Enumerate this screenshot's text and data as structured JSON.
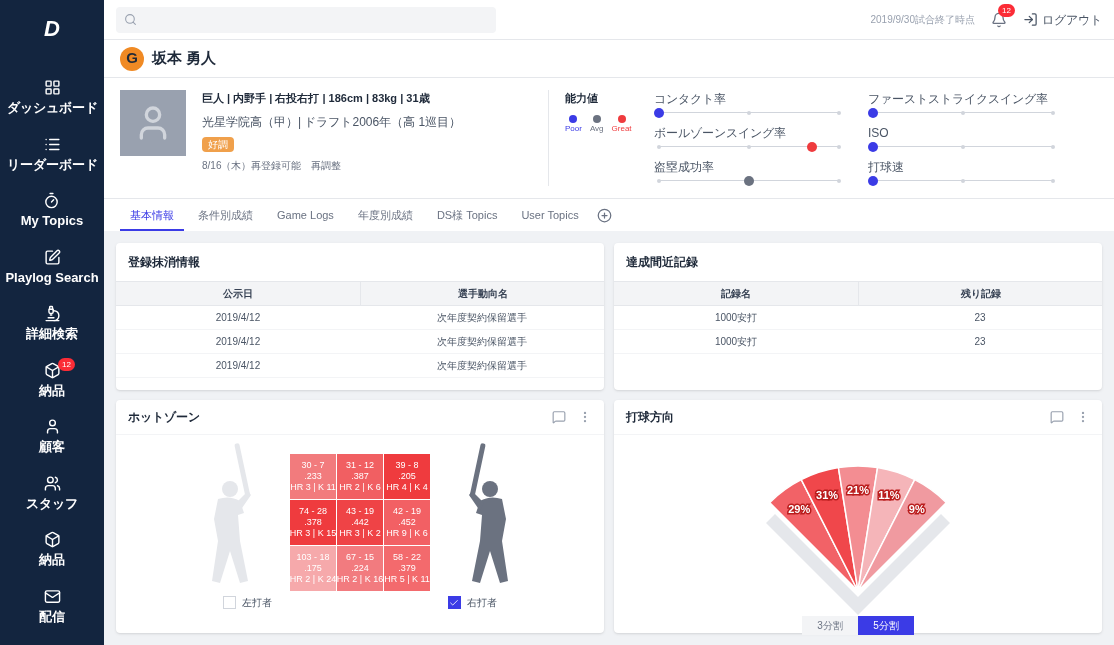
{
  "header": {
    "status": "2019/9/30試合終了時点",
    "notification_count": "12",
    "logout": "ログアウト"
  },
  "sidebar": {
    "logo": "D",
    "items": [
      {
        "label": "ダッシュボード"
      },
      {
        "label": "リーダーボード"
      },
      {
        "label": "My Topics"
      },
      {
        "label": "Playlog Search"
      },
      {
        "label": "詳細検索"
      },
      {
        "label": "納品",
        "badge": "12"
      },
      {
        "label": "顧客"
      },
      {
        "label": "スタッフ"
      },
      {
        "label": "納品"
      },
      {
        "label": "配信"
      }
    ]
  },
  "player": {
    "team_mark": "G",
    "name": "坂本 勇人",
    "profile": "巨人 | 内野手 | 右投右打 | 186cm | 83kg | 31歳",
    "background": "光星学院高（甲）| ドラフト2006年（高 1巡目）",
    "tag": "好調",
    "note": "8/16（木）再登録可能　再調整"
  },
  "ability": {
    "title": "能力値",
    "legend": [
      {
        "label": "Poor",
        "color": "#3b3be6"
      },
      {
        "label": "Avg",
        "color": "#6b7280"
      },
      {
        "label": "Great",
        "color": "#ef3b3e"
      }
    ],
    "metrics": [
      {
        "label": "コンタクト率",
        "level": 0,
        "color": "#3b3be6"
      },
      {
        "label": "ファーストストライクスイング率",
        "level": 0,
        "color": "#3b3be6"
      },
      {
        "label": "ボールゾーンスイング率",
        "level": 0.85,
        "color": "#ef3b3e"
      },
      {
        "label": "ISO",
        "level": 0,
        "color": "#3b3be6"
      },
      {
        "label": "盗塁成功率",
        "level": 0.5,
        "color": "#6b7280"
      },
      {
        "label": "打球速",
        "level": 0,
        "color": "#3b3be6"
      }
    ]
  },
  "tabs": [
    {
      "label": "基本情報",
      "selected": true
    },
    {
      "label": "条件別成績",
      "selected": false
    },
    {
      "label": "Game Logs",
      "selected": false
    },
    {
      "label": "年度別成績",
      "selected": false
    },
    {
      "label": "DS様 Topics",
      "selected": false
    },
    {
      "label": "User Topics",
      "selected": false
    }
  ],
  "registration": {
    "title": "登録抹消情報",
    "columns": [
      "公示日",
      "選手動向名"
    ],
    "rows": [
      [
        "2019/4/12",
        "次年度契約保留選手"
      ],
      [
        "2019/4/12",
        "次年度契約保留選手"
      ],
      [
        "2019/4/12",
        "次年度契約保留選手"
      ]
    ]
  },
  "records": {
    "title": "達成間近記録",
    "columns": [
      "記録名",
      "残り記録"
    ],
    "rows": [
      [
        "1000安打",
        "23"
      ],
      [
        "1000安打",
        "23"
      ]
    ]
  },
  "hot_zone": {
    "title": "ホットゾーン",
    "cells": [
      {
        "lines": [
          "30 - 7",
          ".233",
          "HR 3 | K 11"
        ],
        "color": "#f27b7d"
      },
      {
        "lines": [
          "31 - 12",
          ".387",
          "HR 2 | K 6"
        ],
        "color": "#f15f62"
      },
      {
        "lines": [
          "39 - 8",
          ".205",
          "HR 4 | K 4"
        ],
        "color": "#ef3b3e"
      },
      {
        "lines": [
          "74 - 28",
          ".378",
          "HR 3 | K 15"
        ],
        "color": "#ef3b3e"
      },
      {
        "lines": [
          "43 - 19",
          ".442",
          "HR 3 | K 2"
        ],
        "color": "#ef4346"
      },
      {
        "lines": [
          "42 - 19",
          ".452",
          "HR 9 | K 6"
        ],
        "color": "#f26064"
      },
      {
        "lines": [
          "103 - 18",
          ".175",
          "HR 2 | K 24"
        ],
        "color": "#f6a9ab"
      },
      {
        "lines": [
          "67 - 15",
          ".224",
          "HR 2 | K 16"
        ],
        "color": "#f27b7f"
      },
      {
        "lines": [
          "58 - 22",
          ".379",
          "HR 5 | K 11"
        ],
        "color": "#f36a6d"
      }
    ],
    "options": [
      {
        "label": "左打者",
        "checked": false
      },
      {
        "label": "右打者",
        "checked": true
      }
    ]
  },
  "spray": {
    "title": "打球方向",
    "segments": [
      {
        "label": "29%",
        "color": "#f26267"
      },
      {
        "label": "31%",
        "color": "#f0474b"
      },
      {
        "label": "21%",
        "color": "#f38d92"
      },
      {
        "label": "11%",
        "color": "#f5b5b9"
      },
      {
        "label": "9%",
        "color": "#f09aa0"
      }
    ],
    "modes": [
      {
        "label": "3分割",
        "selected": false
      },
      {
        "label": "5分割",
        "selected": true
      }
    ]
  }
}
